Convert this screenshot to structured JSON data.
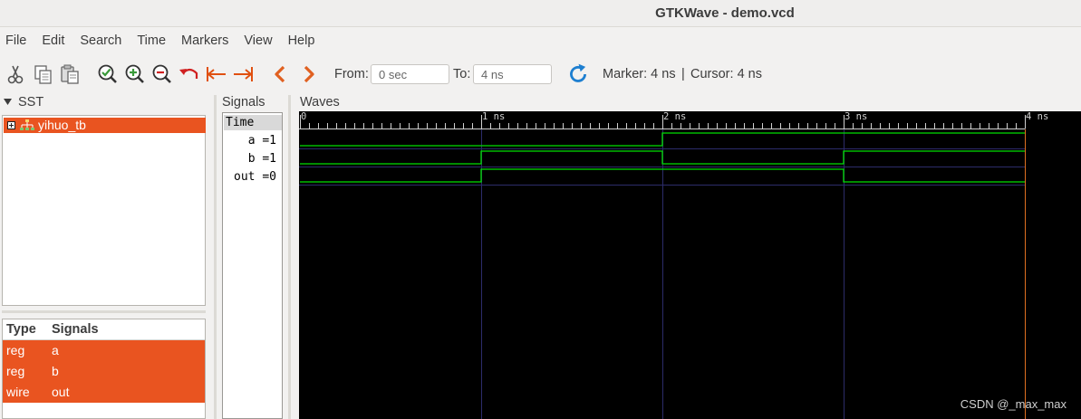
{
  "window": {
    "title": "GTKWave - demo.vcd"
  },
  "menu": [
    "File",
    "Edit",
    "Search",
    "Time",
    "Markers",
    "View",
    "Help"
  ],
  "toolbar": {
    "icons": [
      "cut-icon",
      "copy-icon",
      "paste-icon",
      "zoom-fit-icon",
      "zoom-in-icon",
      "zoom-out-icon",
      "undo-zoom-icon",
      "zoom-to-start-icon",
      "zoom-to-end-icon",
      "previous-page-icon",
      "next-page-icon",
      "reload-icon"
    ],
    "from_label": "From:",
    "from_value": "0 sec",
    "to_label": "To:",
    "to_value": "4 ns",
    "marker_text": "Marker: 4 ns",
    "separator": "|",
    "cursor_text": "Cursor: 4 ns"
  },
  "sst": {
    "header": "SST",
    "tree": [
      {
        "label": "yihuo_tb",
        "expanded": false
      }
    ],
    "table_headers": {
      "type": "Type",
      "signals": "Signals"
    },
    "rows": [
      {
        "type": "reg",
        "signal": "a"
      },
      {
        "type": "reg",
        "signal": "b"
      },
      {
        "type": "wire",
        "signal": "out"
      }
    ]
  },
  "signals_panel": {
    "header": "Signals",
    "time_label": "Time",
    "entries": [
      "a =1",
      "b =1",
      "out =0"
    ]
  },
  "waves": {
    "header": "Waves",
    "axis_labels": [
      "0",
      "1 ns",
      "2 ns",
      "3 ns",
      "4 ns"
    ],
    "time_range_ns": [
      0,
      4
    ],
    "traces": [
      {
        "name": "a",
        "transitions": [
          [
            0,
            0
          ],
          [
            2,
            1
          ]
        ]
      },
      {
        "name": "b",
        "transitions": [
          [
            0,
            0
          ],
          [
            1,
            1
          ],
          [
            2,
            0
          ],
          [
            3,
            1
          ]
        ]
      },
      {
        "name": "out",
        "transitions": [
          [
            0,
            0
          ],
          [
            1,
            1
          ],
          [
            3,
            0
          ]
        ]
      }
    ],
    "marker_ns": 4,
    "colors": {
      "trace": "#00e000",
      "grid": "#2c2c6a",
      "ruler": "#d0d0d0",
      "marker": "#e07020",
      "background": "#000000"
    }
  },
  "watermark": "CSDN @_max_max",
  "colors": {
    "selection": "#e95420"
  }
}
